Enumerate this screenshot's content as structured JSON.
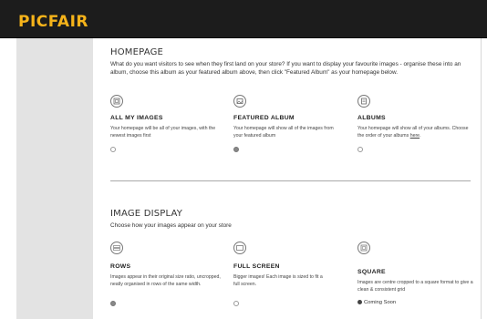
{
  "header": {
    "logo": "PICFAIR"
  },
  "homepage": {
    "title": "HOMEPAGE",
    "intro": "What do you want visitors to see when they first land on your store? If you want to display your favourite images - organise these into an album, choose this album as your featured album above, then click \"Featured Album\" as your homepage below.",
    "options": [
      {
        "title": "ALL MY IMAGES",
        "desc": "Your homepage will be all of your images, with the newest images first",
        "selected": false,
        "icon": "images-icon"
      },
      {
        "title": "FEATURED ALBUM",
        "desc": "Your homepage will show all of the images from your featured album",
        "selected": true,
        "icon": "featured-album-icon"
      },
      {
        "title": "ALBUMS",
        "desc": "Your homepage will show all of your albums. Choose the order of your albums",
        "link": "here",
        "link_suffix": ".",
        "selected": false,
        "icon": "albums-icon"
      }
    ]
  },
  "image_display": {
    "title": "IMAGE DISPLAY",
    "intro": "Choose how your images appear on your store",
    "options": [
      {
        "title": "ROWS",
        "desc": "Images appear in their original size ratio, uncropped, neatly organised in rows of the same width.",
        "selected": true,
        "icon": "rows-icon"
      },
      {
        "title": "FULL SCREEN",
        "desc": "Bigger images! Each image is sized to fit a full screen.",
        "selected": false,
        "icon": "full-screen-icon"
      },
      {
        "title": "SQUARE",
        "desc": "Images are centre cropped to a square format to give a clean & consistent grid",
        "coming_soon": "Coming Soon",
        "icon": "square-icon"
      }
    ]
  }
}
